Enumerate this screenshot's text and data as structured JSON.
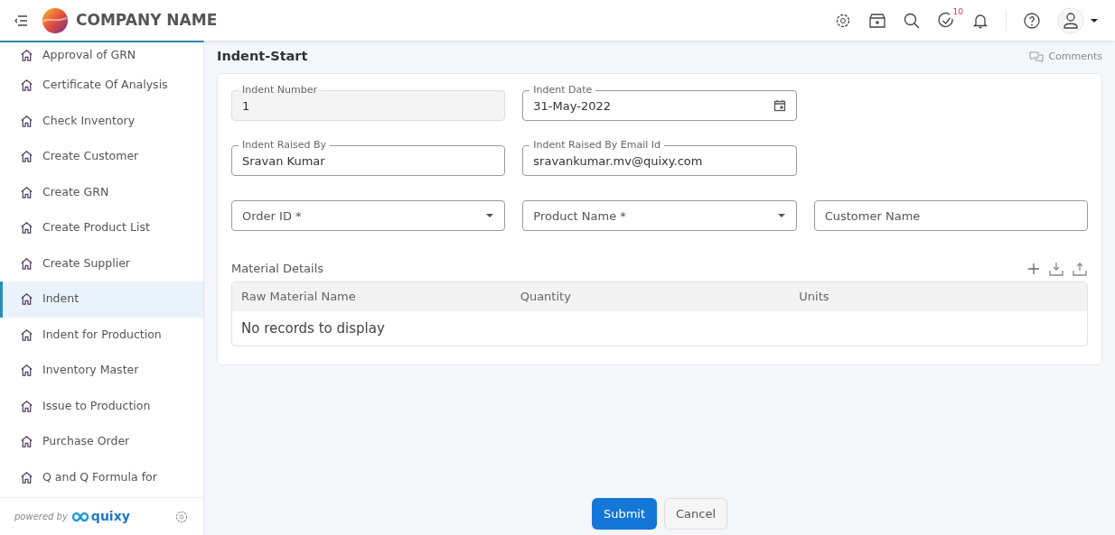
{
  "header": {
    "company": "COMPANY NAME",
    "task_count": "10"
  },
  "sidebar": {
    "items": [
      {
        "label": "Approval of GRN",
        "selected": false
      },
      {
        "label": "Certificate Of Analysis",
        "selected": false
      },
      {
        "label": "Check Inventory",
        "selected": false
      },
      {
        "label": "Create Customer",
        "selected": false
      },
      {
        "label": "Create GRN",
        "selected": false
      },
      {
        "label": "Create Product List",
        "selected": false
      },
      {
        "label": "Create Supplier",
        "selected": false
      },
      {
        "label": "Indent",
        "selected": true
      },
      {
        "label": "Indent for Production",
        "selected": false
      },
      {
        "label": "Inventory Master",
        "selected": false
      },
      {
        "label": "Issue to Production",
        "selected": false
      },
      {
        "label": "Purchase Order",
        "selected": false
      },
      {
        "label": "Q and Q Formula for",
        "selected": false
      }
    ],
    "powered_by": "powered by",
    "brand": "quixy"
  },
  "page": {
    "title": "Indent-Start",
    "comments": "Comments"
  },
  "fields": [
    {
      "kind": "readonly",
      "label": "Indent Number",
      "value": "1"
    },
    {
      "kind": "date",
      "label": "Indent Date",
      "value": "31-May-2022"
    },
    {
      "kind": "spacer"
    },
    {
      "kind": "text",
      "label": "Indent Raised By",
      "value": "Sravan Kumar"
    },
    {
      "kind": "text",
      "label": "Indent Raised By Email Id",
      "value": "sravankumar.mv@quixy.com"
    },
    {
      "kind": "spacer"
    },
    {
      "kind": "select",
      "placeholder": "Order ID *"
    },
    {
      "kind": "select",
      "placeholder": "Product Name *"
    },
    {
      "kind": "text",
      "placeholder": "Customer Name"
    }
  ],
  "table": {
    "title": "Material Details",
    "columns": [
      "Raw Material Name",
      "Quantity",
      "Units"
    ],
    "empty": "No records to display"
  },
  "buttons": [
    "Submit",
    "Cancel"
  ]
}
